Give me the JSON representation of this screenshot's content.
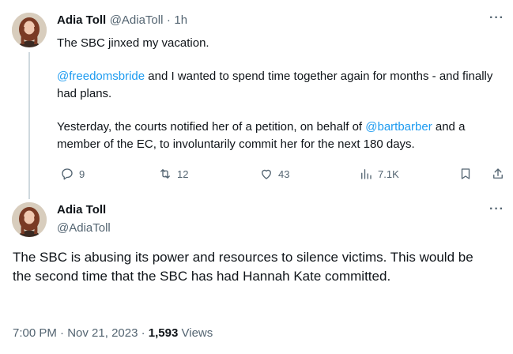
{
  "tweet1": {
    "author_name": "Adia Toll",
    "handle": "@AdiaToll",
    "separator": "·",
    "time": "1h",
    "line1": "The SBC jinxed my vacation.",
    "p2_mention": "@freedomsbride",
    "p2_text": " and I wanted to spend time together again for months - and finally had plans.",
    "p3_pre": "Yesterday, the courts notified her of a petition, on behalf of ",
    "p3_mention": "@bartbarber",
    "p3_post": " and a member of the EC, to involuntarily commit her for the next 180 days.",
    "more": "···",
    "actions": {
      "replies": "9",
      "retweets": "12",
      "likes": "43",
      "views": "7.1K"
    },
    "icons": [
      "reply-icon",
      "retweet-icon",
      "like-icon",
      "views-icon",
      "bookmark-icon",
      "share-icon"
    ]
  },
  "tweet2": {
    "author_name": "Adia Toll",
    "handle": "@AdiaToll",
    "more": "···",
    "body": "The SBC is abusing its power and resources to silence victims. This would be the second time that the SBC has had Hannah Kate committed.",
    "time": "7:00 PM",
    "dot1": "·",
    "date": "Nov 21, 2023",
    "dot2": "·",
    "views_count": "1,593",
    "views_label": "Views"
  },
  "colors": {
    "link": "#1d9bf0",
    "secondary": "#536471",
    "primary": "#0f1419",
    "thread_line": "#cfd9de"
  }
}
